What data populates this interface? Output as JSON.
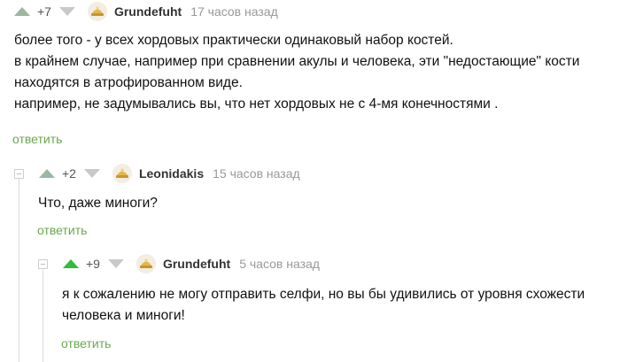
{
  "comments": [
    {
      "rating": "+7",
      "user": "Grundefuht",
      "time": "17 часов назад",
      "lines": [
        "более того - у всех хордовых практически одинаковый набор костей.",
        "в крайнем случае, например при сравнении акулы и человека, эти \"недостающие\" кости",
        "находятся в атрофированном виде.",
        "например, не задумывались вы, что нет хордовых не с 4-мя конечностями ."
      ],
      "reply": "ответить"
    },
    {
      "rating": "+2",
      "user": "Leonidakis",
      "time": "15 часов назад",
      "lines": [
        "Что, даже миноги?"
      ],
      "reply": "ответить"
    },
    {
      "rating": "+9",
      "user": "Grundefuht",
      "time": "5 часов назад",
      "lines": [
        "я к сожалению не могу отправить селфи, но вы бы удивились от уровня схожести",
        "человека и миноги!"
      ],
      "reply": "ответить"
    }
  ],
  "colors": {
    "vote_up": "#2ebd3c",
    "vote_up_muted": "#9bb7a1",
    "reply_link": "#6aa84f",
    "time": "#999999"
  },
  "icons": {
    "upvote": "triangle-up",
    "downvote": "triangle-down",
    "avatar": "default-avatar-hat",
    "collapse": "minus-box"
  }
}
